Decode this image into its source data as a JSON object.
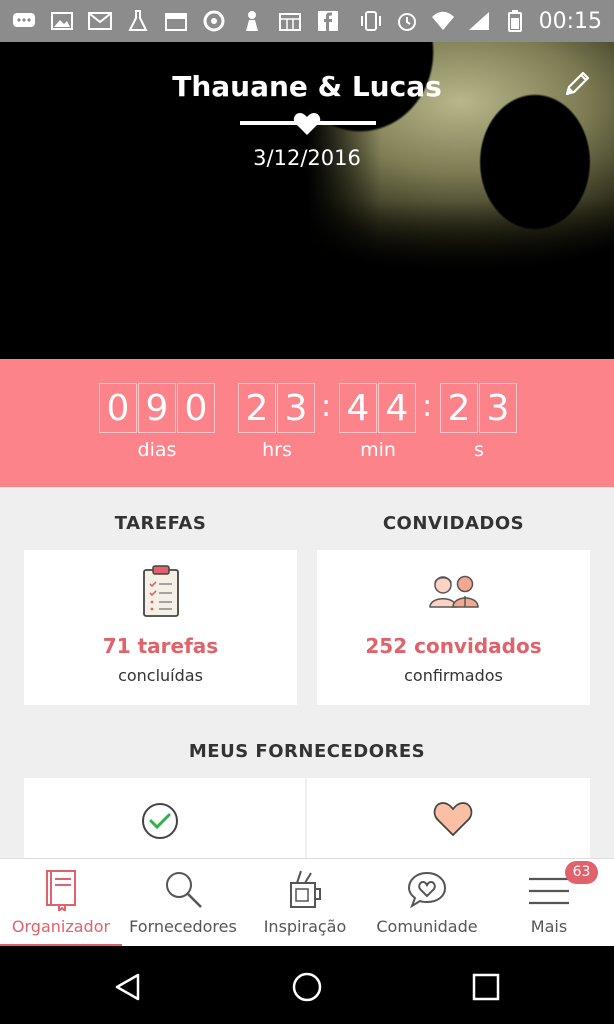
{
  "status_bar": {
    "time": "00:15"
  },
  "hero": {
    "couple_names": "Thauane & Lucas",
    "wedding_date": "3/12/2016"
  },
  "countdown": {
    "days": [
      "0",
      "9",
      "0"
    ],
    "hours": [
      "2",
      "3"
    ],
    "minutes": [
      "4",
      "4"
    ],
    "seconds": [
      "2",
      "3"
    ],
    "labels": {
      "days": "dias",
      "hours": "hrs",
      "minutes": "min",
      "seconds": "s"
    }
  },
  "tasks": {
    "title": "TAREFAS",
    "count": "71 tarefas",
    "subtitle": "concluídas"
  },
  "guests": {
    "title": "CONVIDADOS",
    "count": "252 convidados",
    "subtitle": "confirmados"
  },
  "vendors": {
    "title": "MEUS FORNECEDORES"
  },
  "nav": {
    "items": [
      {
        "label": "Organizador",
        "icon": "notebook-icon",
        "active": true
      },
      {
        "label": "Fornecedores",
        "icon": "search-icon"
      },
      {
        "label": "Inspiração",
        "icon": "inspiration-icon"
      },
      {
        "label": "Comunidade",
        "icon": "chat-heart-icon"
      },
      {
        "label": "Mais",
        "icon": "menu-icon"
      }
    ],
    "badge": "63"
  },
  "colors": {
    "accent": "#fb8389",
    "accent_text": "#e0626a"
  }
}
